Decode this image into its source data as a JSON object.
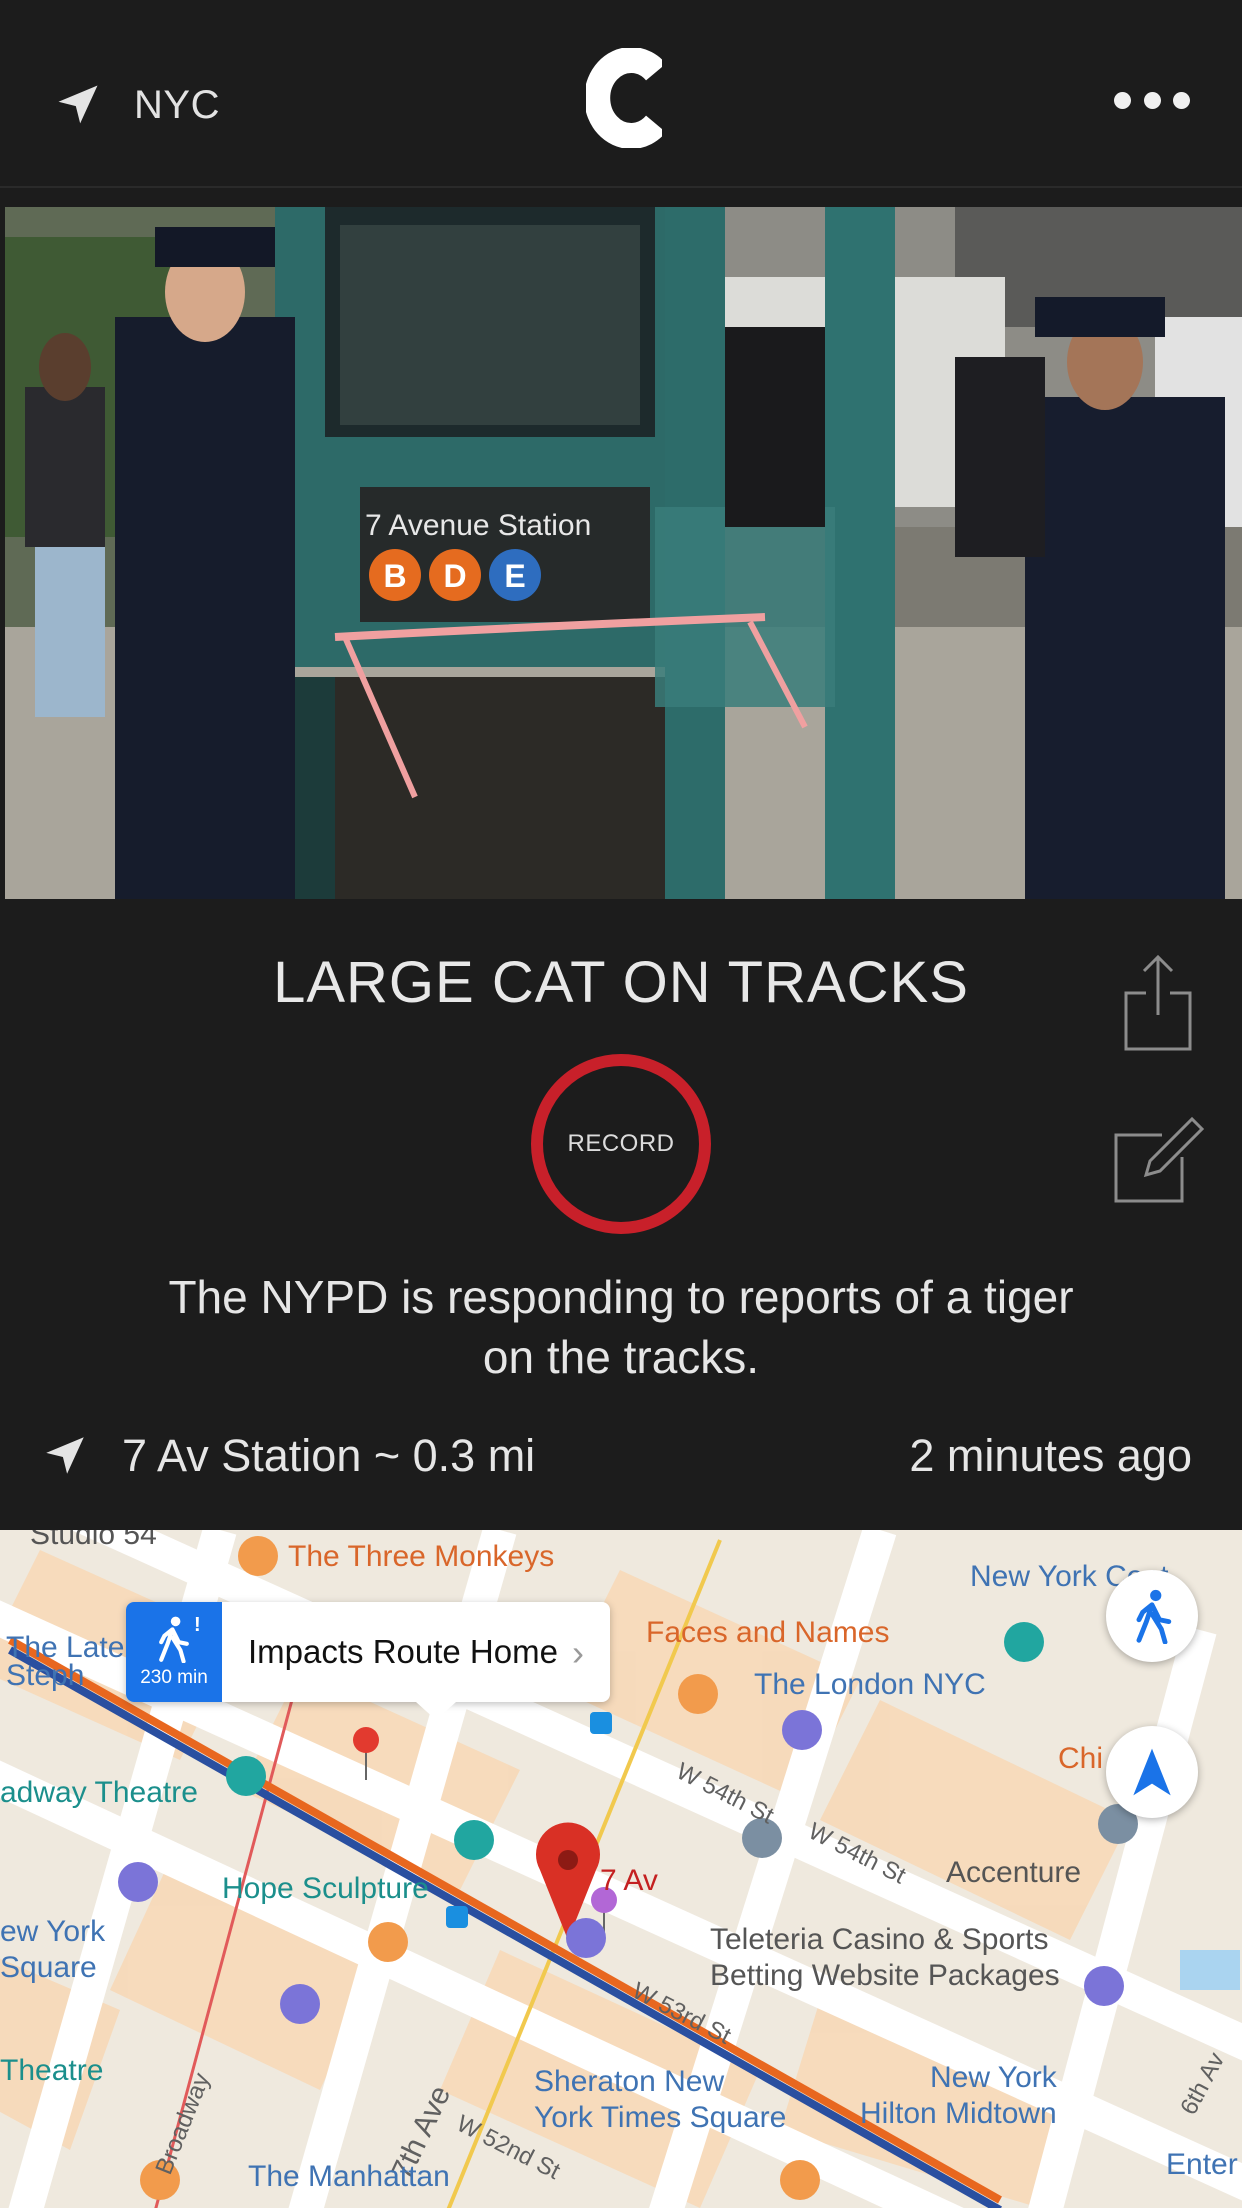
{
  "header": {
    "location_icon": "location-arrow-icon",
    "city": "NYC",
    "logo_letter": "C",
    "menu_icon": "more-horizontal-icon"
  },
  "photo": {
    "sign_text": "7 Avenue Station",
    "lines": [
      "B",
      "D",
      "E"
    ],
    "line_color_orange": "#e56b1f",
    "line_color_blue": "#2e6dbf"
  },
  "story": {
    "headline": "LARGE CAT ON TRACKS",
    "record_label": "RECORD",
    "record_color": "#c8202a",
    "description": "The NYPD is responding to reports of a tiger on the tracks.",
    "location_text": "7 Av Station ~ 0.3 mi",
    "time_ago": "2 minutes ago",
    "share_icon": "share-icon",
    "edit_icon": "edit-icon"
  },
  "map": {
    "route_card": {
      "text": "Impacts Route Home",
      "duration": "230 min",
      "alert": "!",
      "icon": "walk-icon"
    },
    "labels": {
      "three_monkeys": "The Three Monkeys",
      "new_york_cent": "New York Cent",
      "the_late_steph": "The Late Steph",
      "faces_and_names": "Faces and Names",
      "the_london": "The London NYC",
      "chi_mex": "Chi Mex",
      "broadway_theatre": "adway Theatre",
      "w54_a": "W 54th St",
      "w54_b": "W 54th St",
      "seven_av": "7 Av",
      "accenture": "Accenture",
      "hope_sculpture": "Hope Sculpture",
      "new_york_square": "ew York\nSquare",
      "teleteria": "Teleteria Casino & Sports\nBetting Website Packages",
      "w53": "W 53rd St",
      "theatre": "Theatre",
      "broadway": "Broadway",
      "seventh_ave": "7th Ave",
      "sheraton": "Sheraton New\nYork Times Square",
      "ny_hilton": "New York\nHilton Midtown",
      "sixth_av": "6th Av",
      "w52": "W 52nd St",
      "manhattan": "The Manhattan",
      "enter": "Enter",
      "studio": "Studio 54"
    },
    "route_color": "#e8671f",
    "pin_color": "#d93025"
  }
}
